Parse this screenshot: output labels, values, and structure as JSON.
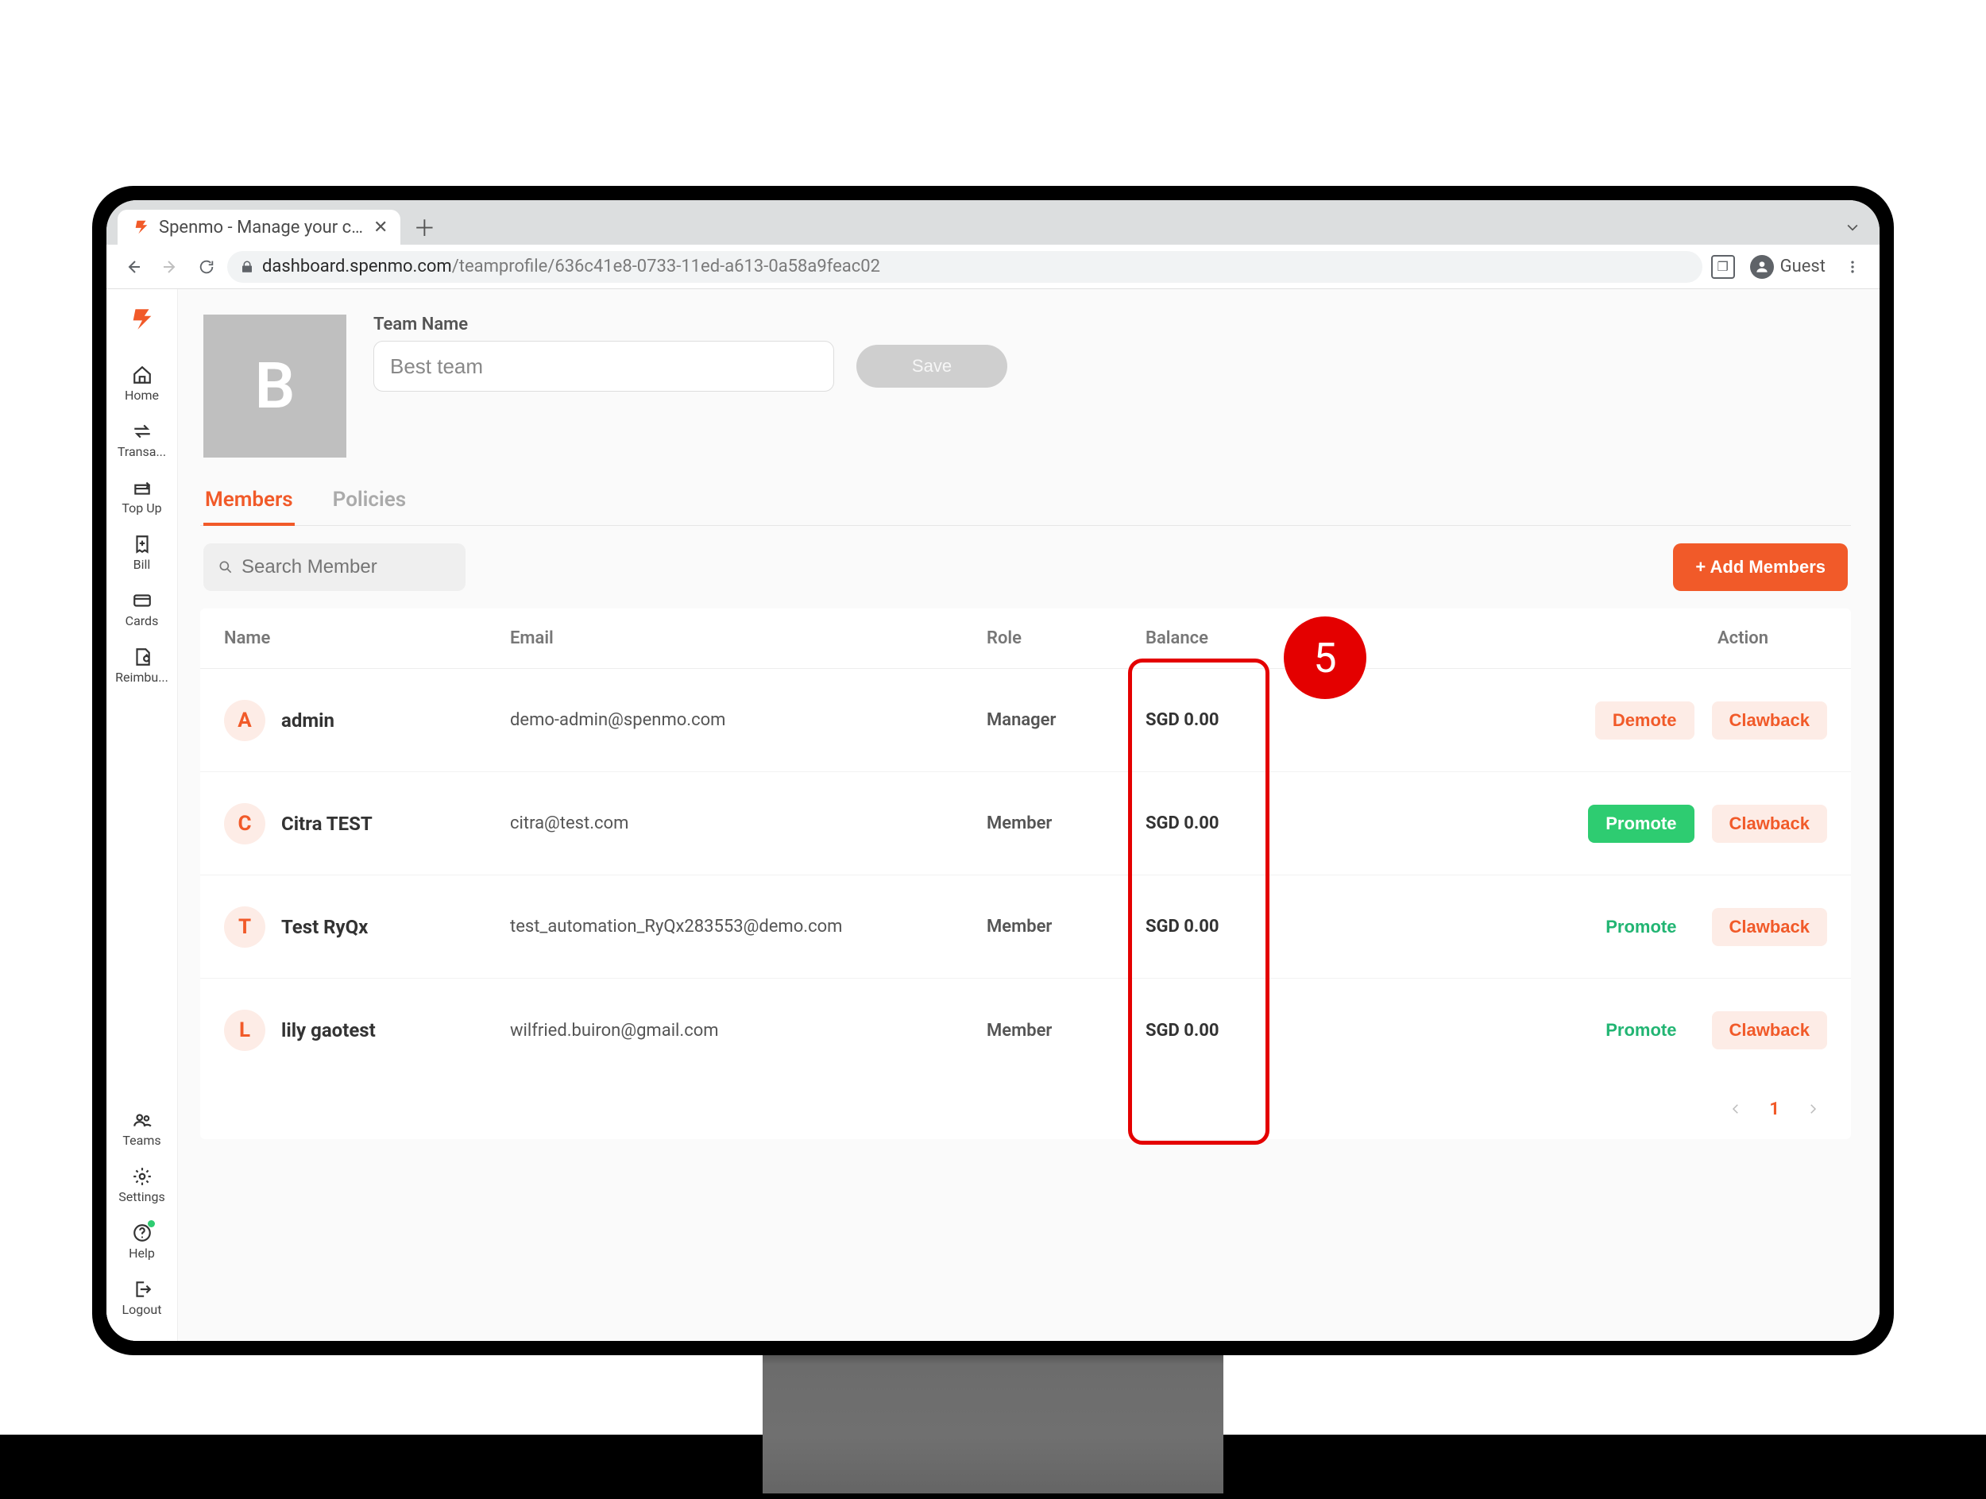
{
  "browser": {
    "tab_title": "Spenmo - Manage your compa",
    "guest_label": "Guest",
    "url_host": "dashboard.spenmo.com",
    "url_path": "/teamprofile/636c41e8-0733-11ed-a613-0a58a9feac02"
  },
  "sidebar": {
    "items": [
      {
        "label": "Home"
      },
      {
        "label": "Transa..."
      },
      {
        "label": "Top Up"
      },
      {
        "label": "Bill"
      },
      {
        "label": "Cards"
      },
      {
        "label": "Reimbu..."
      }
    ],
    "bottom_items": [
      {
        "label": "Teams"
      },
      {
        "label": "Settings"
      },
      {
        "label": "Help"
      },
      {
        "label": "Logout"
      }
    ]
  },
  "team": {
    "avatar_initial": "B",
    "name_label": "Team Name",
    "name_value": "Best team",
    "save_label": "Save"
  },
  "tabs": {
    "members": "Members",
    "policies": "Policies"
  },
  "toolbar": {
    "search_placeholder": "Search Member",
    "add_members_label": "+ Add Members"
  },
  "table": {
    "headers": {
      "name": "Name",
      "email": "Email",
      "role": "Role",
      "balance": "Balance",
      "action": "Action"
    },
    "rows": [
      {
        "initial": "A",
        "name": "admin",
        "email": "demo-admin@spenmo.com",
        "role": "Manager",
        "balance": "SGD 0.00",
        "action_primary": "Demote",
        "action_primary_style": "orange-ghost",
        "action_secondary": "Clawback"
      },
      {
        "initial": "C",
        "name": "Citra TEST",
        "email": "citra@test.com",
        "role": "Member",
        "balance": "SGD 0.00",
        "action_primary": "Promote",
        "action_primary_style": "green",
        "action_secondary": "Clawback"
      },
      {
        "initial": "T",
        "name": "Test RyQx",
        "email": "test_automation_RyQx283553@demo.com",
        "role": "Member",
        "balance": "SGD 0.00",
        "action_primary": "Promote",
        "action_primary_style": "text-green",
        "action_secondary": "Clawback"
      },
      {
        "initial": "L",
        "name": "lily gaotest",
        "email": "wilfried.buiron@gmail.com",
        "role": "Member",
        "balance": "SGD 0.00",
        "action_primary": "Promote",
        "action_primary_style": "text-green",
        "action_secondary": "Clawback"
      }
    ]
  },
  "pagination": {
    "current": "1"
  },
  "annotation": {
    "number": "5"
  }
}
